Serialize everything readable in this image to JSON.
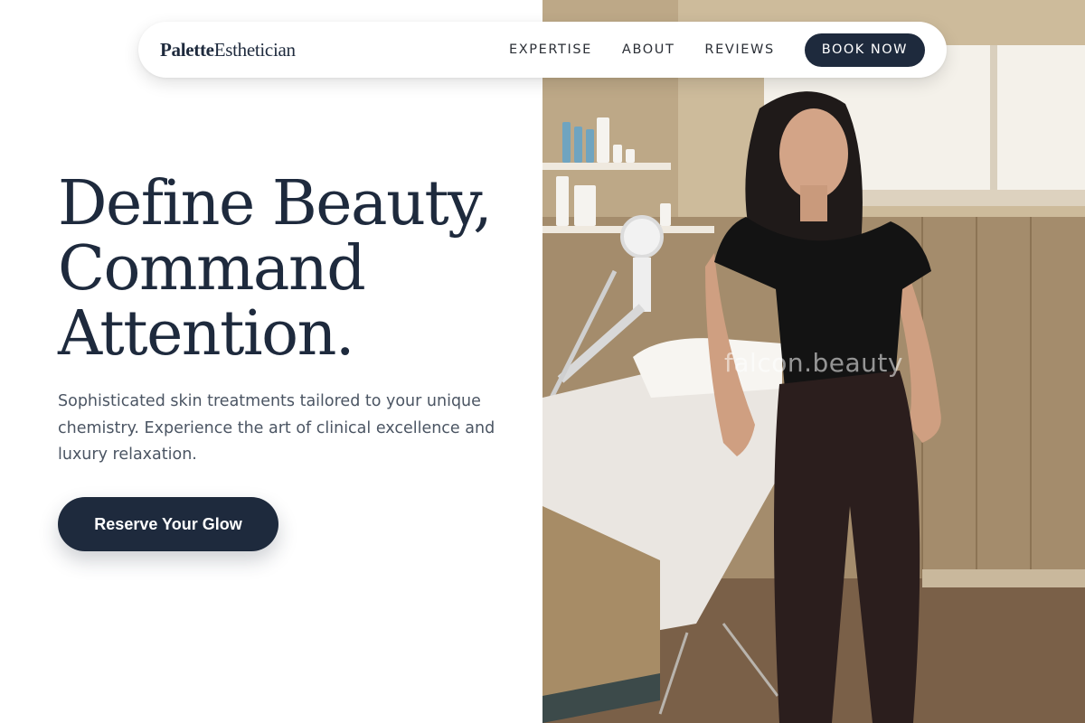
{
  "nav": {
    "logo_bold": "Palette",
    "logo_regular": "Esthetician",
    "links": [
      "EXPERTISE",
      "ABOUT",
      "REVIEWS"
    ],
    "cta_label": "BOOK NOW"
  },
  "hero": {
    "headline_lines": [
      "Define Beauty,",
      "Command",
      "Attention."
    ],
    "description": "Sophisticated skin treatments tailored to your unique chemistry. Experience the art of clinical excellence and luxury relaxation.",
    "cta_label": "Reserve Your Glow"
  },
  "photo": {
    "watermark": "falcon.beauty"
  },
  "colors": {
    "primary": "#1e2a3d",
    "text_muted": "#4b5563",
    "background": "#ffffff"
  }
}
